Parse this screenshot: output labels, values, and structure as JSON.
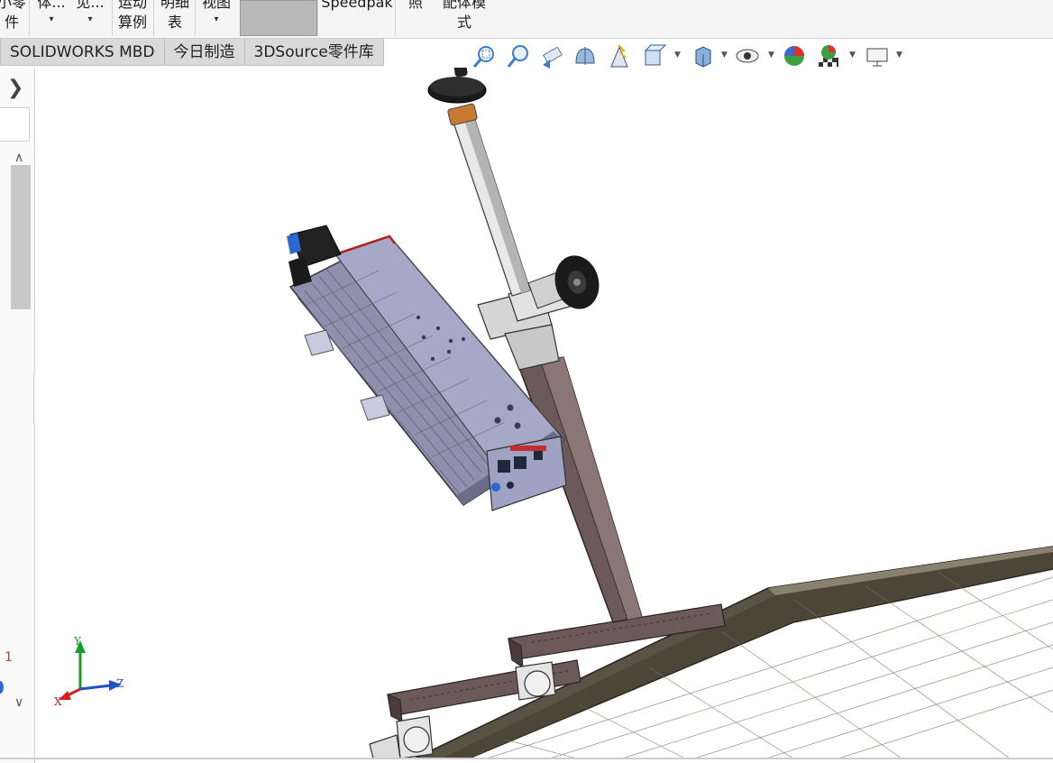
{
  "ribbon": {
    "items": [
      {
        "label": "小零",
        "label2": "件",
        "caret": ""
      },
      {
        "label": "体...",
        "label2": "",
        "caret": "▾"
      },
      {
        "label": "见...",
        "label2": "",
        "caret": "▾"
      },
      {
        "label": "运动",
        "label2": "算例",
        "caret": ""
      },
      {
        "label": "明细",
        "label2": "表",
        "caret": ""
      },
      {
        "label": "视图",
        "label2": "",
        "caret": "▾"
      },
      {
        "label": "Speedpak",
        "label2": "",
        "caret": ""
      },
      {
        "label": "照",
        "label2": "",
        "caret": ""
      },
      {
        "label": "配体模",
        "label2": "式",
        "caret": ""
      }
    ]
  },
  "tabs": [
    {
      "label": "SOLIDWORKS MBD"
    },
    {
      "label": "今日制造"
    },
    {
      "label": "3DSource零件库"
    }
  ],
  "hud_icons": [
    "zoom-to-fit-icon",
    "zoom-to-area-icon",
    "previous-view-icon",
    "section-view-icon",
    "dynamic-annotation-icon",
    "view-orientation-icon",
    "display-style-icon",
    "hide-show-items-icon",
    "edit-appearance-icon",
    "apply-scene-icon",
    "view-settings-icon"
  ],
  "left_panel": {
    "expand_glyph": "❯",
    "scroll_up_glyph": "∧",
    "scroll_down_glyph": "∨",
    "side_number": "1"
  },
  "triad": {
    "x_label": "X",
    "y_label": "Y",
    "z_label": "Z"
  },
  "colors": {
    "accent_blue": "#2a6ad0",
    "triad_x": "#d42020",
    "triad_y": "#1a9a2a",
    "triad_z": "#2050c8",
    "frame_brown": "#6b5a58",
    "panel_dark": "#4d4638",
    "laser_body": "#a6a8c8"
  }
}
